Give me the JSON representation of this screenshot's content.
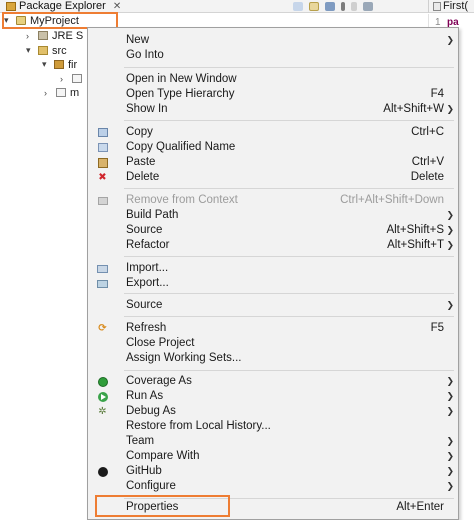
{
  "tabbar": {
    "view_title": "Package Explorer",
    "close_glyph": "✕",
    "editor_tab_label": "First("
  },
  "editor": {
    "line_number": "1",
    "code_fragment": "pa"
  },
  "tree": {
    "project": "MyProject",
    "jre": "JRE S",
    "src": "src",
    "package": "fir",
    "file": "",
    "other": "m"
  },
  "menu": {
    "items": [
      {
        "label": "New",
        "accel": "",
        "submenu": true,
        "icon": ""
      },
      {
        "label": "Go Into",
        "accel": "",
        "submenu": false,
        "icon": ""
      },
      {
        "label": "Open in New Window",
        "accel": "",
        "submenu": false,
        "icon": ""
      },
      {
        "label": "Open Type Hierarchy",
        "accel": "F4",
        "submenu": false,
        "icon": ""
      },
      {
        "label": "Show In",
        "accel": "Alt+Shift+W",
        "submenu": true,
        "icon": ""
      },
      {
        "label": "Copy",
        "accel": "Ctrl+C",
        "submenu": false,
        "icon": "copy-icon"
      },
      {
        "label": "Copy Qualified Name",
        "accel": "",
        "submenu": false,
        "icon": "copy-qualified-name-icon"
      },
      {
        "label": "Paste",
        "accel": "Ctrl+V",
        "submenu": false,
        "icon": "paste-icon"
      },
      {
        "label": "Delete",
        "accel": "Delete",
        "submenu": false,
        "icon": "delete-icon"
      },
      {
        "label": "Remove from Context",
        "accel": "Ctrl+Alt+Shift+Down",
        "submenu": false,
        "icon": "remove-from-context-icon",
        "disabled": true
      },
      {
        "label": "Build Path",
        "accel": "",
        "submenu": true,
        "icon": ""
      },
      {
        "label": "Source",
        "accel": "Alt+Shift+S",
        "submenu": true,
        "icon": ""
      },
      {
        "label": "Refactor",
        "accel": "Alt+Shift+T",
        "submenu": true,
        "icon": ""
      },
      {
        "label": "Import...",
        "accel": "",
        "submenu": false,
        "icon": "import-icon"
      },
      {
        "label": "Export...",
        "accel": "",
        "submenu": false,
        "icon": "export-icon"
      },
      {
        "label": "Source",
        "accel": "",
        "submenu": true,
        "icon": ""
      },
      {
        "label": "Refresh",
        "accel": "F5",
        "submenu": false,
        "icon": "refresh-icon"
      },
      {
        "label": "Close Project",
        "accel": "",
        "submenu": false,
        "icon": ""
      },
      {
        "label": "Assign Working Sets...",
        "accel": "",
        "submenu": false,
        "icon": ""
      },
      {
        "label": "Coverage As",
        "accel": "",
        "submenu": true,
        "icon": "coverage-icon"
      },
      {
        "label": "Run As",
        "accel": "",
        "submenu": true,
        "icon": "run-icon"
      },
      {
        "label": "Debug As",
        "accel": "",
        "submenu": true,
        "icon": "debug-icon"
      },
      {
        "label": "Restore from Local History...",
        "accel": "",
        "submenu": false,
        "icon": ""
      },
      {
        "label": "Team",
        "accel": "",
        "submenu": true,
        "icon": ""
      },
      {
        "label": "Compare With",
        "accel": "",
        "submenu": true,
        "icon": ""
      },
      {
        "label": "GitHub",
        "accel": "",
        "submenu": true,
        "icon": "github-icon"
      },
      {
        "label": "Configure",
        "accel": "",
        "submenu": true,
        "icon": ""
      },
      {
        "label": "Properties",
        "accel": "Alt+Enter",
        "submenu": false,
        "icon": ""
      }
    ]
  },
  "colors": {
    "highlight_border": "#ee7d33",
    "menu_background": "#f2f2f2",
    "disabled_text": "#9c9c9c"
  }
}
